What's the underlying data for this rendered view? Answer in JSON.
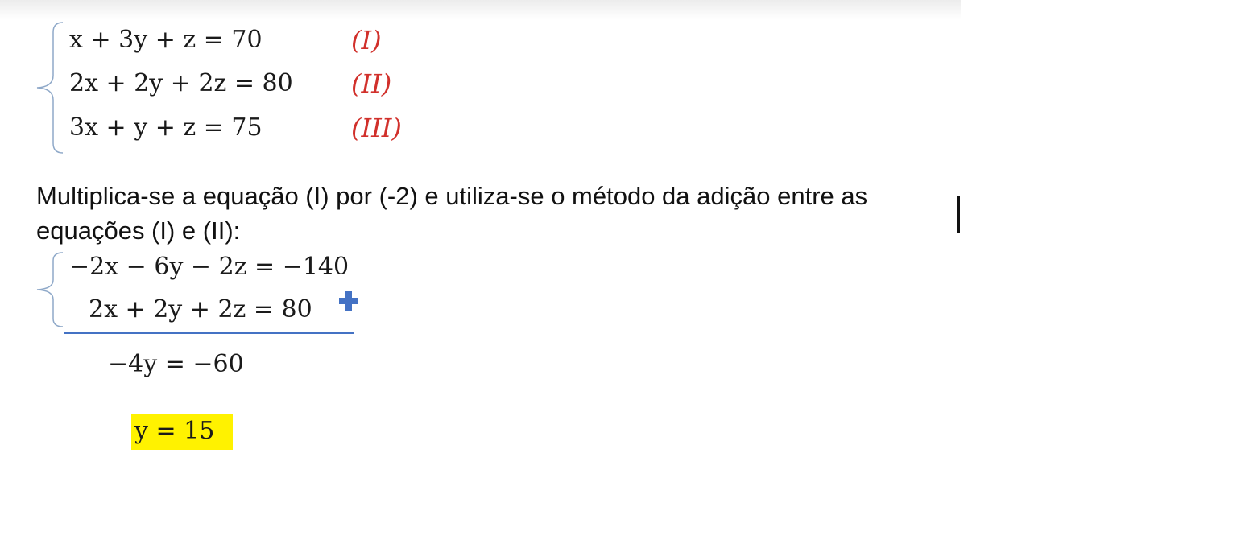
{
  "system1": {
    "equations": [
      {
        "text": "x + 3y + z = 70",
        "label": "(I)"
      },
      {
        "text": "2x + 2y + 2z = 80",
        "label": "(II)"
      },
      {
        "text": "3x + y + z = 75",
        "label": "(III)"
      }
    ]
  },
  "instruction": "Multiplica-se a equação (I) por (-2) e utiliza-se o método da adição entre as equações (I) e (II):",
  "system2": {
    "equations": [
      "−2x − 6y − 2z = −140",
      "2x + 2y + 2z = 80"
    ],
    "operator_icon": "plus-icon"
  },
  "result": "−4y = −60",
  "answer": "y = 15",
  "colors": {
    "label": "#d1302b",
    "brace": "#8fa9c9",
    "rule": "#4472c4",
    "plus": "#4472c4",
    "highlight": "#fff200"
  }
}
